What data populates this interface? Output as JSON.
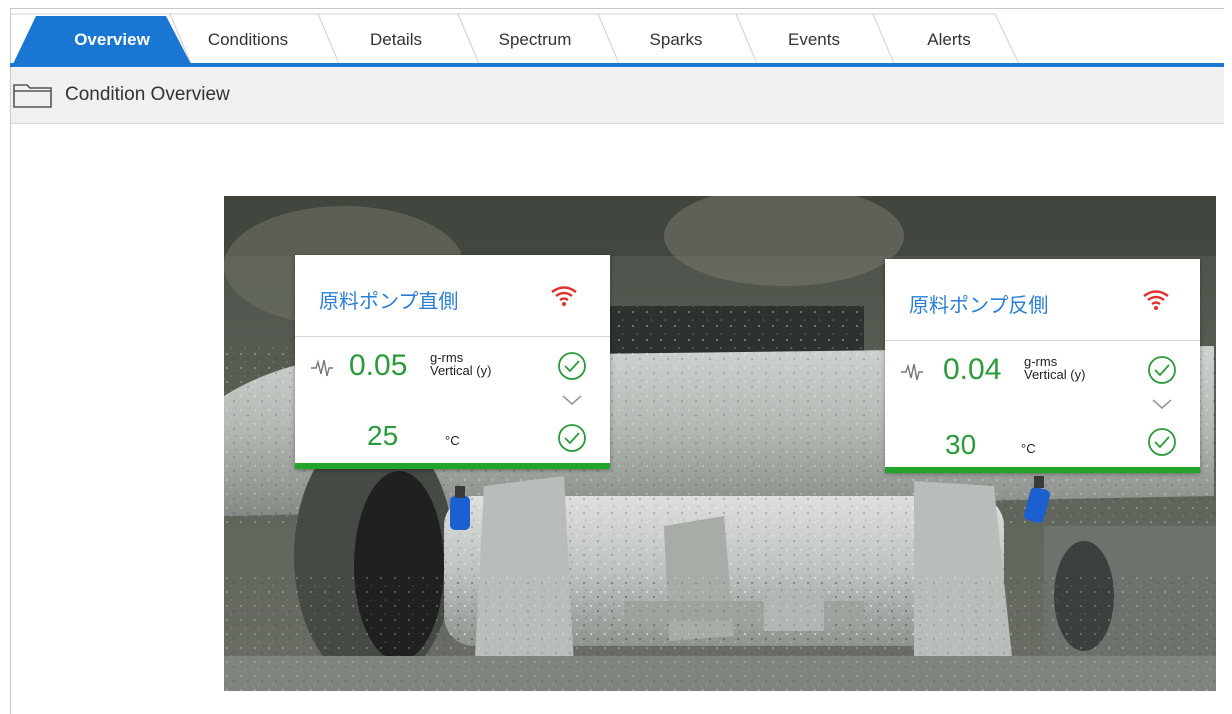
{
  "tabs": [
    {
      "label": "Overview",
      "active": true
    },
    {
      "label": "Conditions",
      "active": false
    },
    {
      "label": "Details",
      "active": false
    },
    {
      "label": "Spectrum",
      "active": false
    },
    {
      "label": "Sparks",
      "active": false
    },
    {
      "label": "Events",
      "active": false
    },
    {
      "label": "Alerts",
      "active": false
    }
  ],
  "header": {
    "title": "Condition Overview",
    "icon": "folder-icon"
  },
  "colors": {
    "accent": "#1976d2",
    "ok": "#2b9a3a",
    "status_bar": "#22a32a",
    "wifi": "#e0312c",
    "title": "#2a7fd4"
  },
  "sensors": [
    {
      "name": "原料ポンプ直側",
      "vibration_value": "0.05",
      "vibration_unit": "g-rms",
      "vibration_axis": "Vertical (y)",
      "temperature_value": "25",
      "temperature_unit": "°C",
      "status": "ok"
    },
    {
      "name": "原料ポンプ反側",
      "vibration_value": "0.04",
      "vibration_unit": "g-rms",
      "vibration_axis": "Vertical (y)",
      "temperature_value": "30",
      "temperature_unit": "°C",
      "status": "ok"
    }
  ]
}
